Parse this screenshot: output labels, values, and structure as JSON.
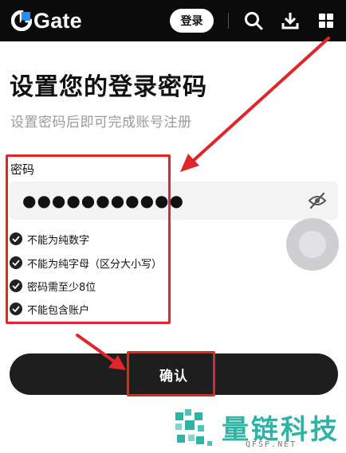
{
  "header": {
    "logo_text": "Gate",
    "login_label": "登录",
    "icons": [
      "gate-logo-icon",
      "search-icon",
      "download-icon",
      "grid-menu-icon"
    ]
  },
  "page": {
    "title": "设置您的登录密码",
    "subtitle": "设置密码后即可完成账号注册"
  },
  "password": {
    "label": "密码",
    "value": "●●●●●●●●●●●",
    "visibility_icon": "eye-off-icon"
  },
  "rules": [
    {
      "text": "不能为纯数字"
    },
    {
      "text": "不能为纯字母（区分大小写）"
    },
    {
      "text": "密码需至少8位"
    },
    {
      "text": "不能包含账户"
    }
  ],
  "confirm_label": "确认",
  "watermark": {
    "text": "量链科技",
    "sub": "QFSP.NET"
  },
  "colors": {
    "header_bg": "#0b0b0b",
    "annotation_red": "#e0262a",
    "button_dark": "#1e1e1e",
    "watermark_teal": "#2fb3a5"
  }
}
